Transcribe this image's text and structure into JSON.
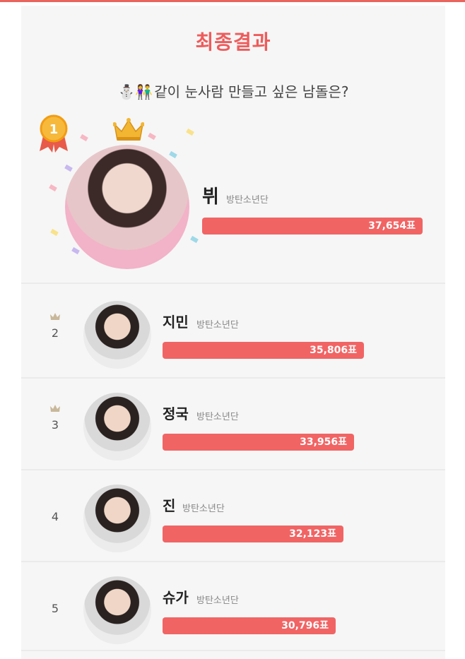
{
  "header": {
    "title": "최종결과",
    "subtitle_emoji": "⛄👫",
    "subtitle": "같이 눈사람 만들고 싶은 남돌은?"
  },
  "winner": {
    "rank": "1",
    "name": "뷔",
    "group": "방탄소년단",
    "votes": "37,654표",
    "share": 1.0
  },
  "results": [
    {
      "rank": "2",
      "name": "지민",
      "group": "방탄소년단",
      "votes": "35,806표",
      "share": 0.951
    },
    {
      "rank": "3",
      "name": "정국",
      "group": "방탄소년단",
      "votes": "33,956표",
      "share": 0.902
    },
    {
      "rank": "4",
      "name": "진",
      "group": "방탄소년단",
      "votes": "32,123표",
      "share": 0.853
    },
    {
      "rank": "5",
      "name": "슈가",
      "group": "방탄소년단",
      "votes": "30,796표",
      "share": 0.818
    }
  ],
  "colors": {
    "accent": "#f16464",
    "title": "#ef5b5b",
    "crown_gold": "#f2b632",
    "crown_gray": "#c8b89a"
  },
  "icons": [
    "medal-icon",
    "crown-icon",
    "snowman-icon",
    "couple-icon"
  ]
}
